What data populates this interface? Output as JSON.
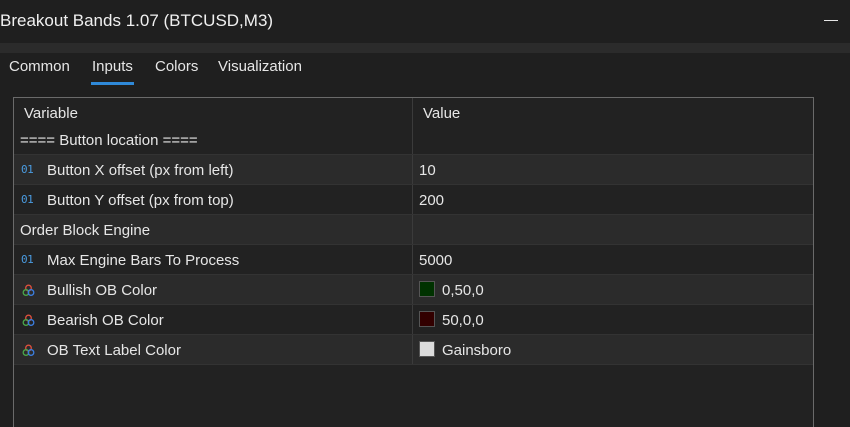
{
  "window": {
    "title": "Breakout Bands 1.07 (BTCUSD,M3)"
  },
  "tabs": [
    {
      "label": "Common"
    },
    {
      "label": "Inputs"
    },
    {
      "label": "Colors"
    },
    {
      "label": "Visualization"
    }
  ],
  "grid": {
    "headers": {
      "variable": "Variable",
      "value": "Value"
    },
    "rows": [
      {
        "variable": "==== Button location ====",
        "value": "",
        "icon": "none"
      },
      {
        "variable": "Button X offset (px from left)",
        "value": "10",
        "icon": "integer-icon"
      },
      {
        "variable": "Button Y offset (px from top)",
        "value": "200",
        "icon": "integer-icon"
      },
      {
        "variable": "Order Block Engine",
        "value": "",
        "icon": "none"
      },
      {
        "variable": "Max Engine Bars To Process",
        "value": "5000",
        "icon": "integer-icon"
      },
      {
        "variable": "Bullish OB Color",
        "value": "0,50,0",
        "icon": "color-icon",
        "swatch": "#003200"
      },
      {
        "variable": "Bearish OB Color",
        "value": "50,0,0",
        "icon": "color-icon",
        "swatch": "#320000"
      },
      {
        "variable": "OB Text Label Color",
        "value": "Gainsboro",
        "icon": "color-icon",
        "swatch": "#dcdcdc"
      }
    ]
  },
  "icons": {
    "integer": "01"
  },
  "colors": {
    "accent": "#2f89d8",
    "integer_icon": "#4a9be0"
  }
}
